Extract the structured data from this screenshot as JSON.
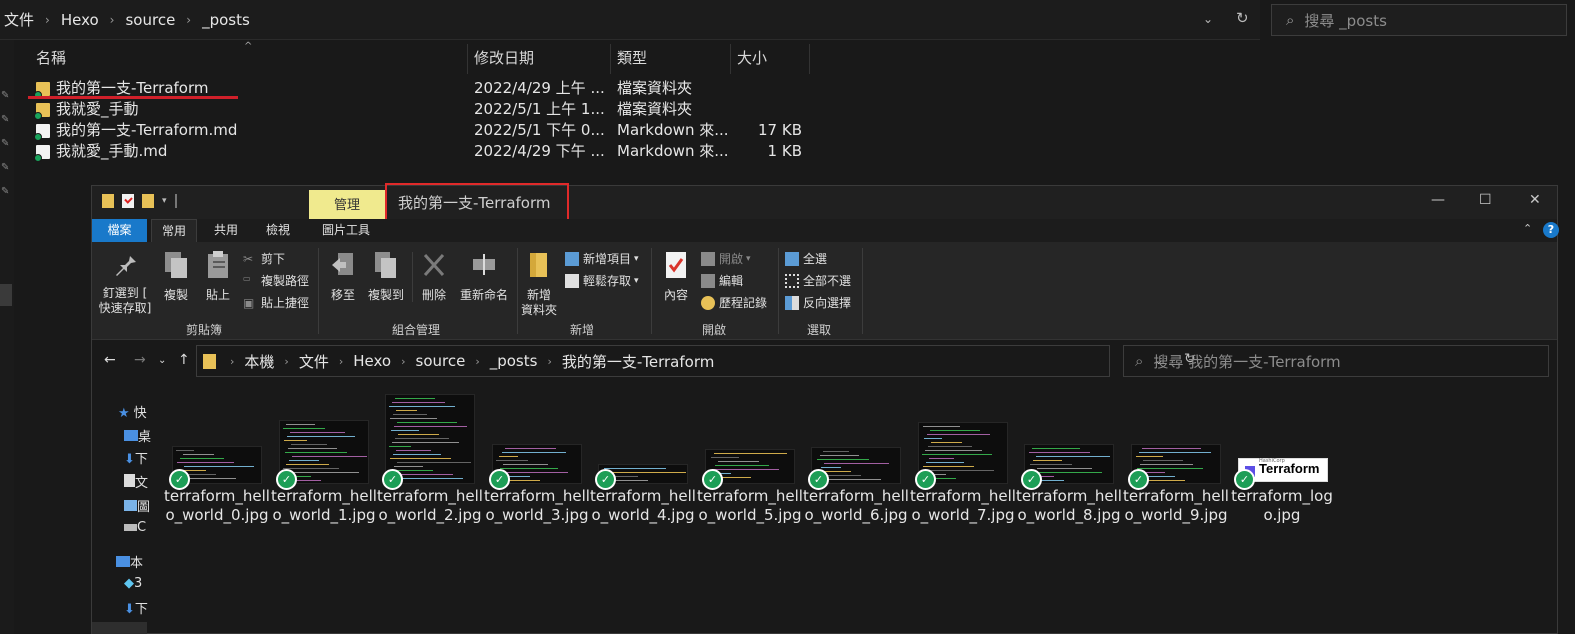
{
  "bg_explorer": {
    "breadcrumb": [
      "文件",
      "Hexo",
      "source",
      "_posts"
    ],
    "search_placeholder": "搜尋 _posts",
    "columns": {
      "name": "名稱",
      "modified": "修改日期",
      "type": "類型",
      "size": "大小"
    },
    "rows": [
      {
        "name": "我的第一支-Terraform",
        "modified": "2022/4/29 上午 ...",
        "type": "檔案資料夾",
        "size": "",
        "icon": "folder-icon",
        "highlighted": true
      },
      {
        "name": "我就愛_手動",
        "modified": "2022/5/1 上午 1...",
        "type": "檔案資料夾",
        "size": "",
        "icon": "folder-icon"
      },
      {
        "name": "我的第一支-Terraform.md",
        "modified": "2022/5/1 下午 0...",
        "type": "Markdown 來...",
        "size": "17 KB",
        "icon": "markdown-file-icon"
      },
      {
        "name": "我就愛_手動.md",
        "modified": "2022/4/29 下午 ...",
        "type": "Markdown 來...",
        "size": "1 KB",
        "icon": "markdown-file-icon"
      }
    ]
  },
  "window": {
    "manage_tab": "管理",
    "title": "我的第一支-Terraform",
    "ribbon_tabs": [
      "檔案",
      "常用",
      "共用",
      "檢視",
      "圖片工具"
    ],
    "clipboard": {
      "pin_line1": "釘選到 [",
      "pin_line2": "快速存取]",
      "copy": "複製",
      "paste": "貼上",
      "cut": "剪下",
      "copy_path": "複製路徑",
      "paste_shortcut": "貼上捷徑",
      "group": "剪貼簿"
    },
    "organize": {
      "move_to": "移至",
      "copy_to": "複製到",
      "delete": "刪除",
      "rename": "重新命名",
      "group": "組合管理"
    },
    "new": {
      "new_folder_line1": "新增",
      "new_folder_line2": "資料夾",
      "new_item": "新增項目",
      "easy_access": "輕鬆存取",
      "group": "新增"
    },
    "open": {
      "properties": "內容",
      "open": "開啟",
      "edit": "編輯",
      "history": "歷程記錄",
      "group": "開啟"
    },
    "select": {
      "select_all": "全選",
      "select_none": "全部不選",
      "invert": "反向選擇",
      "group": "選取"
    },
    "address": [
      "本機",
      "文件",
      "Hexo",
      "source",
      "_posts",
      "我的第一支-Terraform"
    ],
    "search_placeholder": "搜尋 我的第一支-Terraform",
    "nav_pane": [
      "快",
      "桌",
      "下",
      "文",
      "圖",
      "C",
      "本",
      "3",
      "下"
    ],
    "files": [
      "terraform_hello_world_0.jpg",
      "terraform_hello_world_1.jpg",
      "terraform_hello_world_2.jpg",
      "terraform_hello_world_3.jpg",
      "terraform_hello_world_4.jpg",
      "terraform_hello_world_5.jpg",
      "terraform_hello_world_6.jpg",
      "terraform_hello_world_7.jpg",
      "terraform_hello_world_8.jpg",
      "terraform_hello_world_9.jpg",
      "terraform_logo.jpg"
    ],
    "logo": {
      "brand_small": "HashiCorp",
      "brand": "Terraform"
    }
  },
  "colors": {
    "accent": "#1979ca",
    "manage_tab": "#f0ea8e",
    "highlight": "#e02a2a",
    "sync_ok": "#1d9e56"
  }
}
